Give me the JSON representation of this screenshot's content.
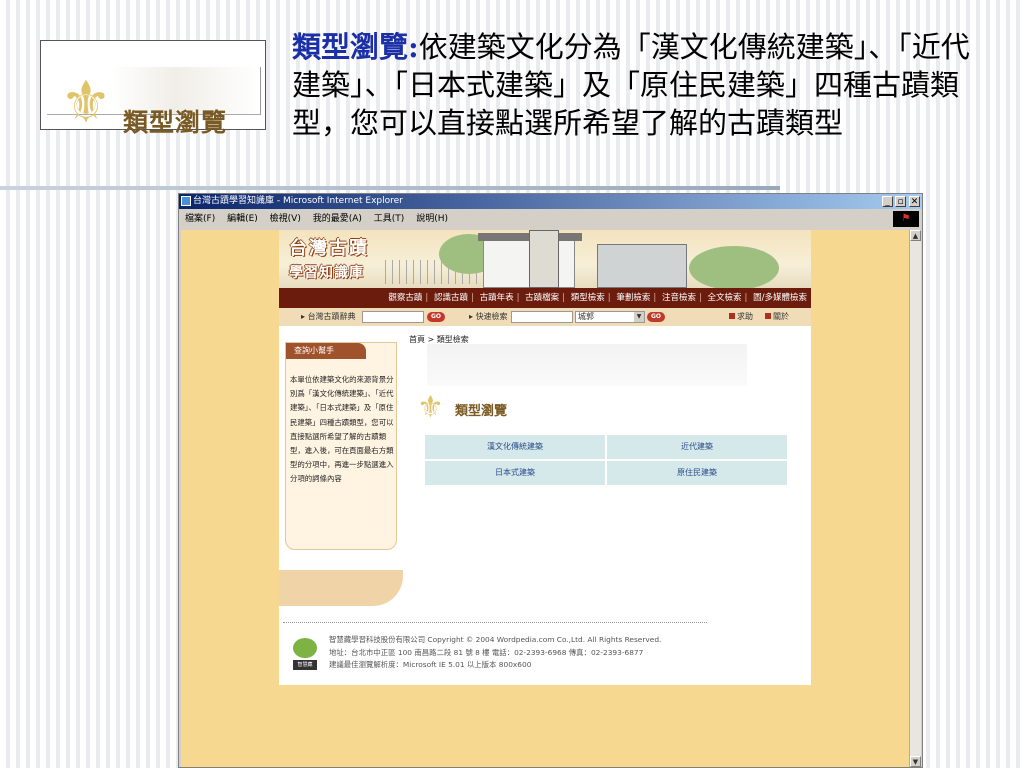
{
  "slide": {
    "logo_text": "類型瀏覽",
    "desc_title": "類型瀏覽",
    "desc_colon": ":",
    "desc_body": "依建築文化分為「漢文化傳統建築」、「近代建築」、「日本式建築」及「原住民建築」四種古蹟類型，您可以直接點選所希望了解的古蹟類型"
  },
  "browser": {
    "title": "台灣古蹟學習知識庫 - Microsoft Internet Explorer",
    "menu": [
      "檔案(F)",
      "編輯(E)",
      "檢視(V)",
      "我的最愛(A)",
      "工具(T)",
      "說明(H)"
    ],
    "minimize": "_",
    "maximize": "▫",
    "close": "✕"
  },
  "site": {
    "title_line1": "台灣古蹟",
    "title_line2": "學習知識庫",
    "nav": [
      "觀察古蹟",
      "認識古蹟",
      "古蹟年表",
      "古蹟檔案",
      "類型檢索",
      "筆劃檢索",
      "注音檢索",
      "全文檢索",
      "圖/多媒體檢索"
    ],
    "dict_label": "台灣古蹟辭典",
    "quick_label": "快速檢索",
    "go_label": "GO",
    "select_value": "城郭",
    "help_label": "求助",
    "close_label": "關於"
  },
  "helper": {
    "title": "查詢小幫手",
    "text": "本單位依建築文化的來源背景分別爲「漢文化傳統建築」、「近代建築」、「日本式建築」及「原住民建築」四種古蹟類型，您可以直接點選所希望了解的古蹟類型，進入後，可在頁面最右方類型的分項中，再進一步點選進入分項的詞條內容"
  },
  "main": {
    "breadcrumb_home": "首頁",
    "breadcrumb_current": "類型檢索",
    "category_logo_text": "類型瀏覽",
    "categories": [
      "漢文化傳統建築",
      "近代建築",
      "日本式建築",
      "原住民建築"
    ]
  },
  "footer": {
    "logo_text": "智慧藏",
    "line1": "智慧藏學習科技股份有限公司 Copyright © 2004 Wordpedia.com Co.,Ltd. All Rights Reserved.",
    "line2": "地址：台北市中正區 100 南昌路二段 81 號 8 樓 電話：02-2393-6968 傳真：02-2393-6877",
    "line3": "建議最佳瀏覽解析度：Microsoft IE 5.01 以上版本 800x600"
  }
}
